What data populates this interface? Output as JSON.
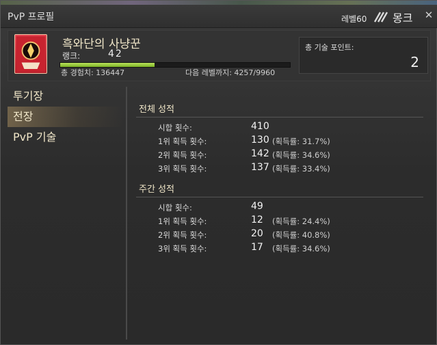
{
  "window": {
    "title": "PvP 프로필",
    "level_label": "레벨60",
    "job_name": "몽크",
    "close_glyph": "✕"
  },
  "profile": {
    "name": "흑와단의 사냥꾼",
    "rank_label": "랭크:",
    "rank_value": "42",
    "exp_progress": 0.41,
    "exp_total": "총 경험치: 136447",
    "exp_next": "다음 레벨까지: 4257/9960",
    "skill_points_label": "총 기술 포인트:",
    "skill_points_value": "2"
  },
  "nav": {
    "items": [
      {
        "label": "투기장",
        "active": false
      },
      {
        "label": "전장",
        "active": true
      },
      {
        "label": "PvP 기술",
        "active": false
      }
    ]
  },
  "overall": {
    "title": "전체 성적",
    "rows": [
      {
        "label": "시합 횟수:",
        "value": "410",
        "pct": ""
      },
      {
        "label": "1위 획득 횟수:",
        "value": "130",
        "pct": "(획득률: 31.7%)"
      },
      {
        "label": "2위 획득 횟수:",
        "value": "142",
        "pct": "(획득률: 34.6%)"
      },
      {
        "label": "3위 획득 횟수:",
        "value": "137",
        "pct": "(획득률: 33.4%)"
      }
    ]
  },
  "weekly": {
    "title": "주간 성적",
    "rows": [
      {
        "label": "시합 횟수:",
        "value": "49",
        "pct": ""
      },
      {
        "label": "1위 획득 횟수:",
        "value": "12",
        "pct": "(획득률: 24.4%)"
      },
      {
        "label": "2위 획득 횟수:",
        "value": "20",
        "pct": "(획득률: 40.8%)"
      },
      {
        "label": "3위 획득 횟수:",
        "value": "17",
        "pct": "(획득률: 34.6%)"
      }
    ]
  },
  "icons": {
    "job": "monk-job-icon",
    "emblem": "pvp-rank-emblem"
  },
  "colors": {
    "exp_fill": "#9ccb3e",
    "emblem": "#cf2f3b"
  }
}
